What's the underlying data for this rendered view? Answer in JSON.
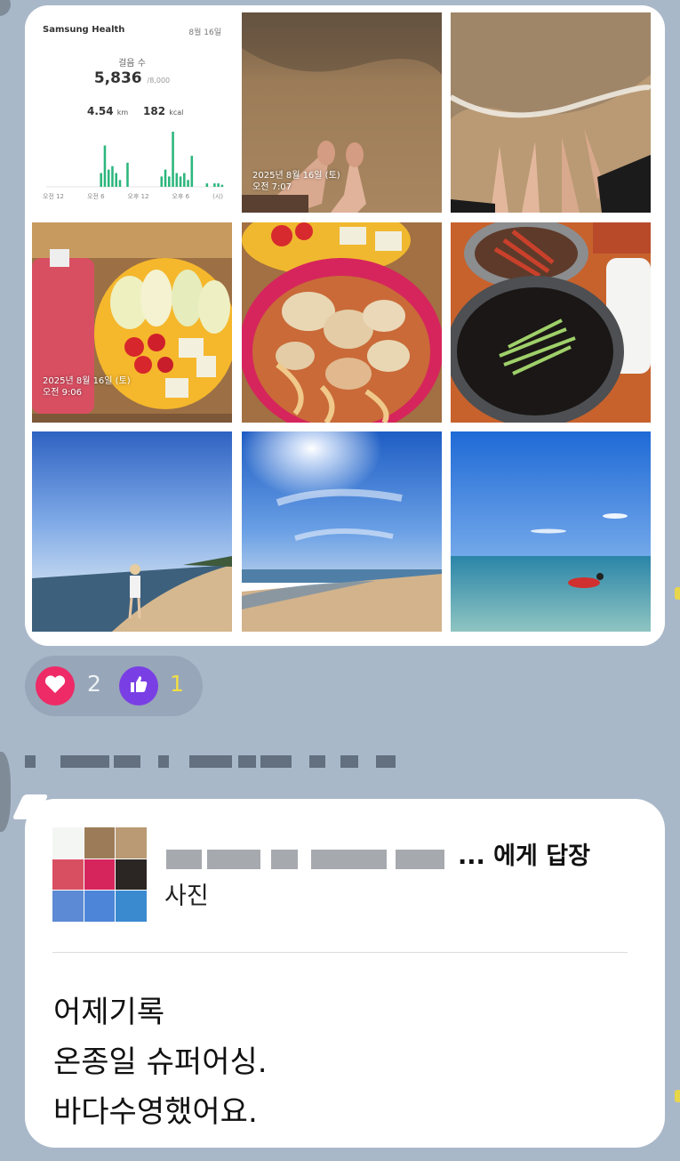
{
  "health_card": {
    "app_name": "Samsung Health",
    "date": "8월 16일",
    "steps_label": "걸음 수",
    "steps": "5,836",
    "steps_goal": "/8,000",
    "distance": "4.54",
    "distance_unit": "km",
    "calories": "182",
    "calories_unit": "kcal",
    "axis_labels": [
      "오전 12",
      "오전 6",
      "오후 12",
      "오후 6",
      "(시)"
    ],
    "hourly_steps": [
      0,
      0,
      0,
      0,
      0,
      0,
      0,
      0,
      0,
      0,
      0,
      0,
      0,
      0,
      20,
      60,
      25,
      30,
      20,
      10,
      0,
      35,
      0,
      0,
      0,
      0,
      0,
      0,
      0,
      0,
      15,
      25,
      15,
      80,
      20,
      15,
      20,
      10,
      45,
      0,
      0,
      0,
      5,
      0,
      5,
      5,
      3
    ],
    "bar_color": "#2cb67d"
  },
  "photos": [
    {
      "name": "beach-feet-sand",
      "stamp": [
        "2025년 8월 16일 (토)",
        "오전 7:07"
      ]
    },
    {
      "name": "beach-feet-waves",
      "stamp": []
    },
    {
      "name": "fruit-snack",
      "stamp": [
        "2025년 8월 16일 (토)",
        "오전 9:06"
      ]
    },
    {
      "name": "clam-noodles",
      "stamp": []
    },
    {
      "name": "black-bean-noodles",
      "stamp": []
    },
    {
      "name": "person-walking-beach",
      "stamp": []
    },
    {
      "name": "sunny-beach-sky",
      "stamp": []
    },
    {
      "name": "swimmer-sea",
      "stamp": []
    }
  ],
  "reactions": {
    "heart_count": "2",
    "like_count": "1",
    "heart_color": "#ee2a67",
    "like_color": "#7a3fe4"
  },
  "reply": {
    "target_suffix": "...  에게 답장",
    "type": "사진",
    "message_lines": [
      "어제기록",
      "온종일 슈퍼어싱.",
      "바다수영했어요."
    ]
  }
}
